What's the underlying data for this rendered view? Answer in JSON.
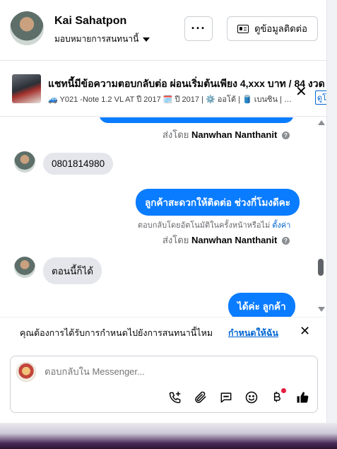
{
  "header": {
    "name": "Kai Sahatpon",
    "assign_label": "มอบหมายการสนทนานี้",
    "more_label": "···",
    "contact_label": "ดูข้อมูลติดต่อ"
  },
  "listing": {
    "title": "แชทนี้มีข้อความตอบกลับต่อ ผ่อนเริ่มต้นเพียง 4,xxx บาท / 84 งวด",
    "subtitle": "🚙 Y021 -Note 1.2 VL AT ปี 2017 🗓️ ปี 2017 | ⚙️ ออโต้ | 🛢️ เบนซิน | …",
    "link_label": "ดูโ"
  },
  "messages": {
    "sentby1_prefix": "ส่งโดย",
    "sentby1_name": "Nanwhan Nanthanit",
    "incoming1": "0801814980",
    "outgoing1": "ลูกค้าสะดวกให้ติดต่อ ช่วงกี่โมงดีคะ",
    "auto_note": "ตอบกลับโดยอัตโนมัติในครั้งหน้าหรือไม่",
    "auto_link": "ตั้งค่า",
    "sentby2_prefix": "ส่งโดย",
    "sentby2_name": "Nanwhan Nanthanit",
    "incoming2": "ตอนนี้ก็ได้",
    "outgoing2": "ได้ค่ะ  ลูกค้า"
  },
  "reminder": {
    "text": "คุณต้องการได้รับการกำหนดไปยังการสนทนานี้ไหม",
    "link": "กำหนดให้ฉัน"
  },
  "composer": {
    "placeholder": "ตอบกลับใน Messenger..."
  },
  "colors": {
    "accent": "#0a7cff",
    "link": "#0064d1",
    "bubble_in": "#e4e6eb",
    "badge": "#e41e3f"
  }
}
